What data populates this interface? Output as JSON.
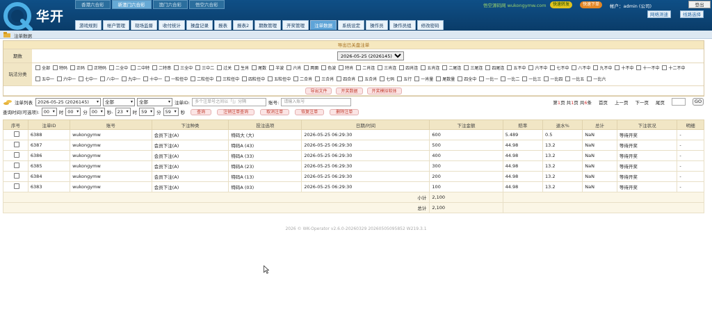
{
  "brand": {
    "name": "华开"
  },
  "lottery_tabs": [
    {
      "label": "香港六合彩",
      "active": false
    },
    {
      "label": "新澳门六合彩",
      "active": true
    },
    {
      "label": "澳门六合彩",
      "active": false
    },
    {
      "label": "悟空六合彩",
      "active": false
    }
  ],
  "header": {
    "site_text": "悟空源码网 wukongymw.com",
    "btn_a": "快速转发",
    "btn_b": "快速下单",
    "account_text": "帐户：admin (公司)",
    "logout": "登出",
    "net_speed": "网络测速",
    "line_select": "线路选择"
  },
  "nav": [
    {
      "label": "游戏规则",
      "active": false
    },
    {
      "label": "帐户管理",
      "active": false
    },
    {
      "label": "现场监督",
      "active": false
    },
    {
      "label": "收付统计",
      "active": false
    },
    {
      "label": "操盘记录",
      "active": false
    },
    {
      "label": "报表",
      "active": false
    },
    {
      "label": "报表2",
      "active": false
    },
    {
      "label": "期数管理",
      "active": false
    },
    {
      "label": "开奖管理",
      "active": false
    },
    {
      "label": "注单数据",
      "active": true
    },
    {
      "label": "系统设定",
      "active": false
    },
    {
      "label": "操作员",
      "active": false
    },
    {
      "label": "操作员组",
      "active": false
    },
    {
      "label": "修改密码",
      "active": false
    }
  ],
  "breadcrumb": "注单数据",
  "filter": {
    "export_title": "导出已关盘注单",
    "period_label": "期数",
    "period_value": "2026-05-25 (2026145)",
    "playtype_label": "玩法分类",
    "playtypes": [
      "全部",
      "特码",
      "正码",
      "正特码",
      "二全中",
      "二中特",
      "二特串",
      "三全中",
      "三中二",
      "过关",
      "生肖",
      "尾数",
      "半波",
      "六肖",
      "两面",
      "色波",
      "特肖",
      "二肖连",
      "三肖连",
      "四肖连",
      "五肖连",
      "二尾连",
      "三尾连",
      "四尾连",
      "五不中",
      "六不中",
      "七不中",
      "八不中",
      "九不中",
      "十不中",
      "十一不中",
      "十二不中",
      "五中一",
      "六中一",
      "七中一",
      "八中一",
      "九中一",
      "十中一",
      "一粒任中",
      "二粒任中",
      "三粒任中",
      "四粒任中",
      "五粒任中",
      "二合肖",
      "三合肖",
      "四合肖",
      "五合肖",
      "七码",
      "五行",
      "一肖量",
      "尾数量",
      "四全中",
      "一比一",
      "一比二",
      "一比三",
      "一比四",
      "一比五",
      "一比六"
    ],
    "actions": [
      "导出文件",
      "开奖数据",
      "开奖模拟软体"
    ]
  },
  "query": {
    "list_label": "注单列表",
    "period_value": "2026-05-25 (2026145)",
    "type1": "全部",
    "type2": "全部",
    "id_label": "注单ID:",
    "id_placeholder": "多个注单号之间以「|」分隔",
    "account_label": "账号:",
    "account_placeholder": "请输入账号",
    "time_label": "查询时间(可选项):",
    "h1": "00",
    "t_hour": "时",
    "m1": "00",
    "t_min": "分",
    "s1": "00",
    "t_sec_to": "秒-",
    "h2": "23",
    "t_hour2": "时",
    "m2": "59",
    "t_min2": "分",
    "s2": "59",
    "t_sec2": "秒",
    "buttons": [
      "查询",
      "注销注单查询",
      "取消注单",
      "恢复注单",
      "删除注单"
    ]
  },
  "pager": {
    "p1": "第",
    "current": "1",
    "p2": "页 共",
    "total_pages": "1",
    "p3": "页 共",
    "total_items": "6",
    "p4": "条",
    "first": "首页",
    "prev": "上一页",
    "next": "下一页",
    "last": "尾页",
    "go": "GO"
  },
  "table": {
    "headers": [
      "序号",
      "注单ID",
      "账号",
      "下注种类",
      "投注选项",
      "日期/时间",
      "下注金额",
      "赔率",
      "退水%",
      "总计",
      "下注状况",
      "明细"
    ],
    "rows": [
      {
        "id": "6388",
        "account": "wukongymw",
        "kind": "会员下注(A)",
        "option": "特码大 (大)",
        "time": "2026-05-25 06:29:30",
        "amount": "600",
        "odds": "5.489",
        "rebate": "0.5",
        "total": "NaN",
        "status": "等待开奖",
        "detail": "-"
      },
      {
        "id": "6387",
        "account": "wukongymw",
        "kind": "会员下注(A)",
        "option": "特码A (43)",
        "time": "2026-05-25 06:29:30",
        "amount": "500",
        "odds": "44.98",
        "rebate": "13.2",
        "total": "NaN",
        "status": "等待开奖",
        "detail": "-"
      },
      {
        "id": "6386",
        "account": "wukongymw",
        "kind": "会员下注(A)",
        "option": "特码A (33)",
        "time": "2026-05-25 06:29:30",
        "amount": "400",
        "odds": "44.98",
        "rebate": "13.2",
        "total": "NaN",
        "status": "等待开奖",
        "detail": "-"
      },
      {
        "id": "6385",
        "account": "wukongymw",
        "kind": "会员下注(A)",
        "option": "特码A (23)",
        "time": "2026-05-25 06:29:30",
        "amount": "300",
        "odds": "44.98",
        "rebate": "13.2",
        "total": "NaN",
        "status": "等待开奖",
        "detail": "-"
      },
      {
        "id": "6384",
        "account": "wukongymw",
        "kind": "会员下注(A)",
        "option": "特码A (13)",
        "time": "2026-05-25 06:29:30",
        "amount": "200",
        "odds": "44.98",
        "rebate": "13.2",
        "total": "NaN",
        "status": "等待开奖",
        "detail": "-"
      },
      {
        "id": "6383",
        "account": "wukongymw",
        "kind": "会员下注(A)",
        "option": "特码A (03)",
        "time": "2026-05-25 06:29:30",
        "amount": "100",
        "odds": "44.98",
        "rebate": "13.2",
        "total": "NaN",
        "status": "等待开奖",
        "detail": "-"
      }
    ],
    "subtotal_label": "小计",
    "subtotal_value": "2,100",
    "total_label": "总计",
    "total_value": "2,100"
  },
  "footer": "2026 © WK-Operator v2.6.0-20260329 20260505095852 W219.3.1",
  "colors": {
    "header_bg": "#0f4f86",
    "accent": "#5ea4d8",
    "table_header": "#f1e6c5",
    "action_red": "#c0392b"
  }
}
